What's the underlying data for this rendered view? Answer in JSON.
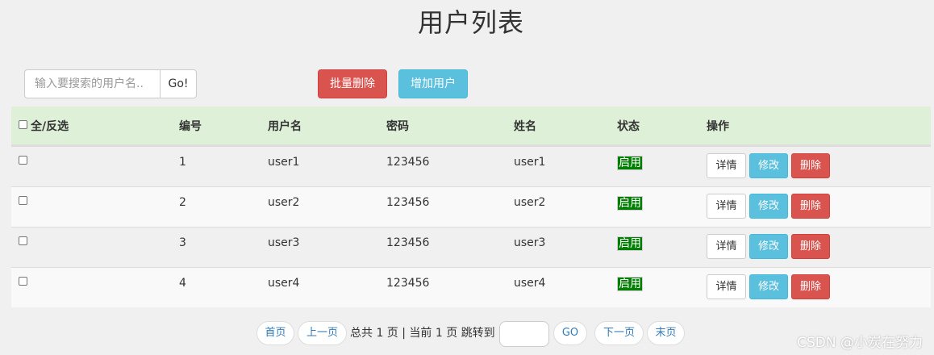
{
  "page": {
    "title": "用户列表"
  },
  "toolbar": {
    "search_placeholder": "输入要搜索的用户名..",
    "go_label": "Go!",
    "batch_delete_label": "批量删除",
    "add_user_label": "增加用户"
  },
  "table": {
    "headers": {
      "select_all": "全/反选",
      "id": "编号",
      "username": "用户名",
      "password": "密码",
      "name": "姓名",
      "status": "状态",
      "actions": "操作"
    },
    "rows": [
      {
        "id": "1",
        "username": "user1",
        "password": "123456",
        "name": "user1",
        "status": "启用"
      },
      {
        "id": "2",
        "username": "user2",
        "password": "123456",
        "name": "user2",
        "status": "启用"
      },
      {
        "id": "3",
        "username": "user3",
        "password": "123456",
        "name": "user3",
        "status": "启用"
      },
      {
        "id": "4",
        "username": "user4",
        "password": "123456",
        "name": "user4",
        "status": "启用"
      }
    ],
    "action_labels": {
      "detail": "详情",
      "edit": "修改",
      "delete": "删除"
    }
  },
  "pagination": {
    "first": "首页",
    "prev": "上一页",
    "info": "总共 1 页 | 当前 1 页 跳转到",
    "go": "GO",
    "next": "下一页",
    "last": "末页",
    "jump_value": ""
  },
  "watermark": "CSDN @小炭在努力",
  "colors": {
    "header_bg": "#dff0d8",
    "danger": "#d9534f",
    "info": "#5bc0de",
    "status_green": "#008000"
  }
}
